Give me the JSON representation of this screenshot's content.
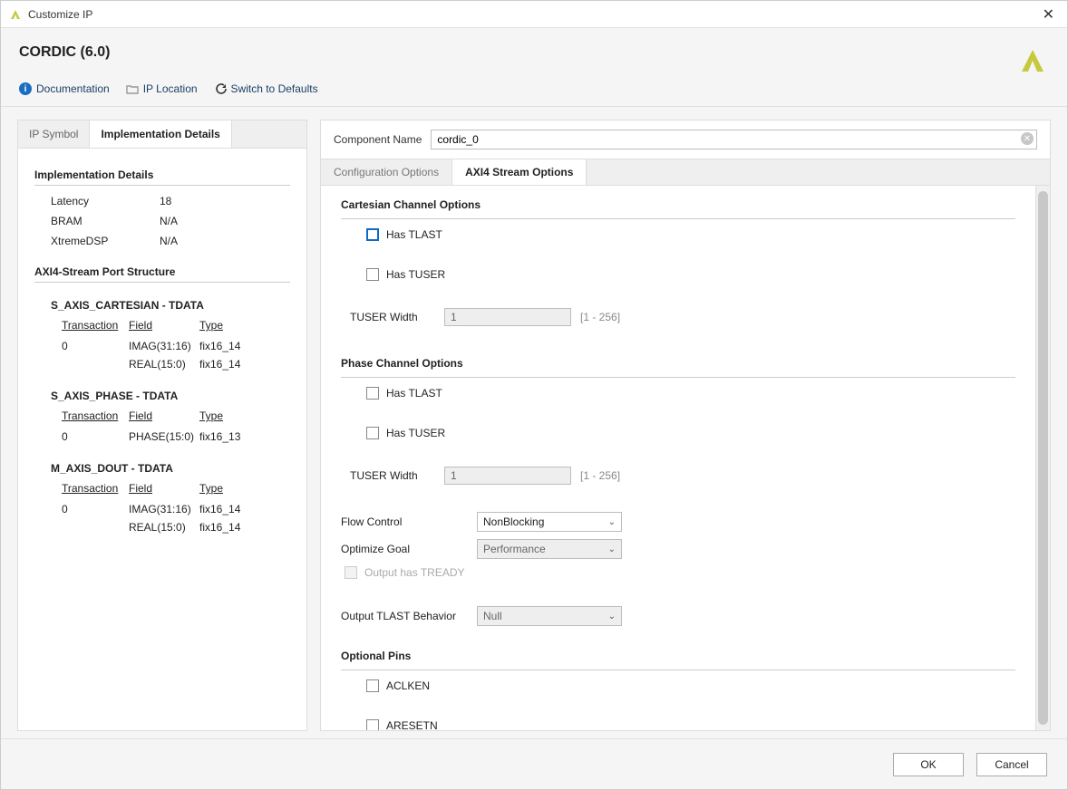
{
  "window": {
    "title": "Customize IP"
  },
  "header": {
    "product_title": "CORDIC (6.0)",
    "toolbar": {
      "documentation": "Documentation",
      "ip_location": "IP Location",
      "switch_defaults": "Switch to Defaults"
    }
  },
  "left": {
    "tabs": {
      "ip_symbol": "IP Symbol",
      "impl_details": "Implementation Details"
    },
    "impl_header": "Implementation Details",
    "impl_rows": {
      "latency_k": "Latency",
      "latency_v": "18",
      "bram_k": "BRAM",
      "bram_v": "N/A",
      "xdsp_k": "XtremeDSP",
      "xdsp_v": "N/A"
    },
    "axi_header": "AXI4-Stream Port Structure",
    "col_headers": {
      "transaction": "Transaction",
      "field": "Field",
      "type": "Type"
    },
    "groups": {
      "cartesian_title": "S_AXIS_CARTESIAN - TDATA",
      "cartesian_rows": [
        {
          "t": "0",
          "f": "IMAG(31:16)",
          "ty": "fix16_14"
        },
        {
          "t": "",
          "f": "REAL(15:0)",
          "ty": "fix16_14"
        }
      ],
      "phase_title": "S_AXIS_PHASE - TDATA",
      "phase_rows": [
        {
          "t": "0",
          "f": "PHASE(15:0)",
          "ty": "fix16_13"
        }
      ],
      "dout_title": "M_AXIS_DOUT - TDATA",
      "dout_rows": [
        {
          "t": "0",
          "f": "IMAG(31:16)",
          "ty": "fix16_14"
        },
        {
          "t": "",
          "f": "REAL(15:0)",
          "ty": "fix16_14"
        }
      ]
    }
  },
  "right": {
    "component_name_label": "Component Name",
    "component_name_value": "cordic_0",
    "tabs": {
      "config": "Configuration Options",
      "axi": "AXI4 Stream Options"
    },
    "cartesian": {
      "title": "Cartesian Channel Options",
      "has_tlast": "Has TLAST",
      "has_tuser": "Has TUSER",
      "tuser_width_label": "TUSER Width",
      "tuser_width_value": "1",
      "tuser_width_range": "[1 - 256]"
    },
    "phase": {
      "title": "Phase Channel Options",
      "has_tlast": "Has TLAST",
      "has_tuser": "Has TUSER",
      "tuser_width_label": "TUSER Width",
      "tuser_width_value": "1",
      "tuser_width_range": "[1 - 256]"
    },
    "flow_control_label": "Flow Control",
    "flow_control_value": "NonBlocking",
    "optimize_goal_label": "Optimize Goal",
    "optimize_goal_value": "Performance",
    "output_tready": "Output has TREADY",
    "output_tlast_label": "Output TLAST Behavior",
    "output_tlast_value": "Null",
    "optional_pins_title": "Optional Pins",
    "aclken": "ACLKEN",
    "aresetn": "ARESETN"
  },
  "footer": {
    "ok": "OK",
    "cancel": "Cancel"
  }
}
